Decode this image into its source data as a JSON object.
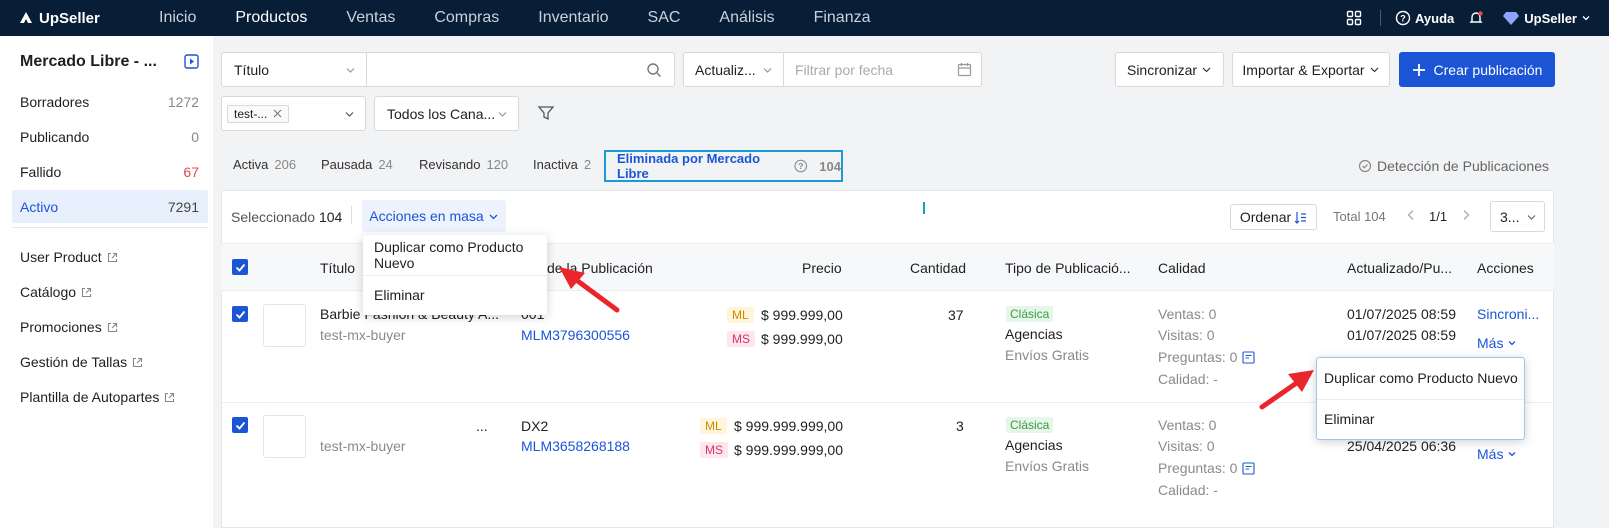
{
  "nav": {
    "brand": "UpSeller",
    "items": [
      "Inicio",
      "Productos",
      "Ventas",
      "Compras",
      "Inventario",
      "SAC",
      "Análisis",
      "Finanza"
    ],
    "help": "Ayuda",
    "account": "UpSeller"
  },
  "sidebar": {
    "title": "Mercado Libre - ...",
    "statuses": [
      {
        "label": "Borradores",
        "count": "1272"
      },
      {
        "label": "Publicando",
        "count": "0"
      },
      {
        "label": "Fallido",
        "count": "67"
      },
      {
        "label": "Activo",
        "count": "7291"
      }
    ],
    "links": [
      "User Product",
      "Catálogo",
      "Promociones",
      "Gestión de Tallas",
      "Plantilla de Autopartes"
    ]
  },
  "filters": {
    "search_field": "Título",
    "search_value": "",
    "date_field": "Actualiz...",
    "date_placeholder": "Filtrar por fecha",
    "store_tag": "test-...",
    "channel": "Todos los Cana..."
  },
  "toolbar": {
    "sync": "Sincronizar",
    "import_export": "Importar & Exportar",
    "create": "Crear publicación"
  },
  "tabs": [
    {
      "label": "Activa",
      "count": "206"
    },
    {
      "label": "Pausada",
      "count": "24"
    },
    {
      "label": "Revisando",
      "count": "120"
    },
    {
      "label": "Inactiva",
      "count": "2"
    },
    {
      "label": "Eliminada por Mercado Libre",
      "count": "104"
    }
  ],
  "detect_link": "Detección de Publicaciones",
  "bulk": {
    "selected_label": "Seleccionado",
    "selected_count": "104",
    "actions": "Acciones en masa",
    "sort": "Ordenar",
    "total": "Total 104",
    "page": "1/1",
    "page_size": "3..."
  },
  "columns": [
    "Título",
    "de la Publicación",
    "Precio",
    "Cantidad",
    "Tipo de Publicació...",
    "Calidad",
    "Actualizado/Pu...",
    "Acciones"
  ],
  "rows": [
    {
      "title": "Barbie Fashion & Beauty A...",
      "seller": "test-mx-buyer",
      "sku": "001",
      "id": "MLM3796300556",
      "price_ml": "$ 999.999,00",
      "price_ms": "$ 999.999,00",
      "qty": "37",
      "type": "Clásica",
      "shipping": "Agencias",
      "free": "Envíos Gratis",
      "ventas": "Ventas: 0",
      "visitas": "Visitas: 0",
      "preguntas": "Preguntas: 0",
      "calidad": "Calidad: -",
      "updated": "01/07/2025 08:59",
      "published": "01/07/2025 08:59",
      "action_main": "Sincroni...",
      "action_more": "Más"
    },
    {
      "title": "...",
      "seller": "test-mx-buyer",
      "sku": "DX2",
      "id": "MLM3658268188",
      "price_ml": "$ 999.999.999,00",
      "price_ms": "$ 999.999.999,00",
      "qty": "3",
      "type": "Clásica",
      "shipping": "Agencias",
      "free": "Envíos Gratis",
      "ventas": "Ventas: 0",
      "visitas": "Visitas: 0",
      "preguntas": "Preguntas: 0",
      "calidad": "Calidad: -",
      "published": "25/04/2025 06:36",
      "action_more": "Más"
    }
  ],
  "menu_bulk": [
    "Duplicar como Producto Nuevo",
    "Eliminar"
  ],
  "menu_row": [
    "Duplicar como Producto Nuevo",
    "Eliminar"
  ],
  "tags": {
    "ml": "ML",
    "ms": "MS"
  },
  "colors": {
    "nav_bg": "#081d36",
    "primary": "#1b55d6",
    "tab_highlight": "#1a9ad6",
    "arrow": "#e8262b"
  }
}
